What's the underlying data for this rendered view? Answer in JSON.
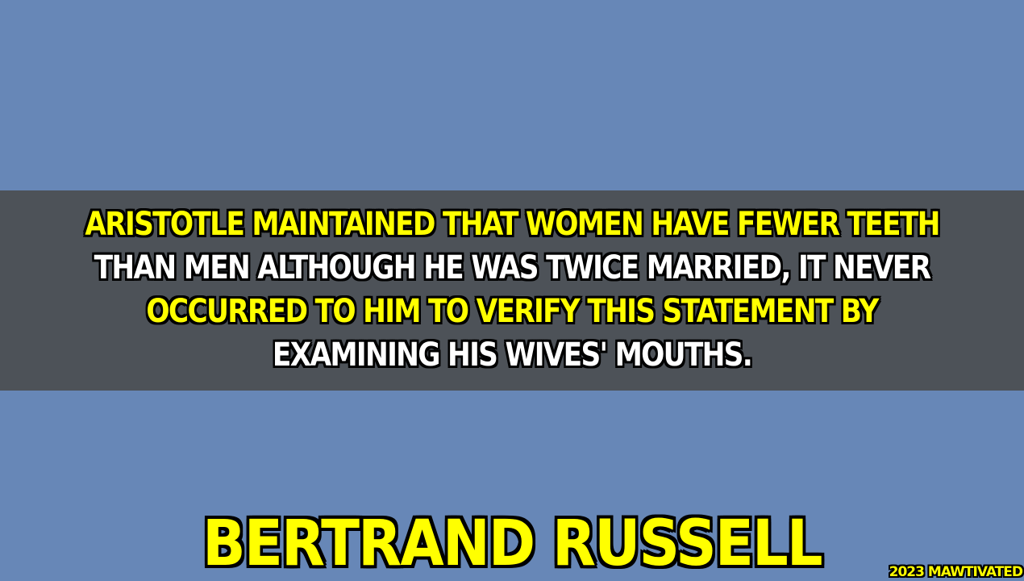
{
  "quote": {
    "lines": [
      "ARISTOTLE MAINTAINED THAT WOMEN HAVE FEWER TEETH",
      "THAN MEN ALTHOUGH HE WAS TWICE MARRIED, IT NEVER",
      "OCCURRED TO HIM TO VERIFY THIS STATEMENT BY",
      "EXAMINING HIS WIVES' MOUTHS."
    ]
  },
  "author": "BERTRAND RUSSELL",
  "credit": "2023 MAWTIVATED",
  "colors": {
    "background": "#6787b7",
    "band": "#4d5258",
    "accent_yellow": "#ffff00",
    "text_white": "#ffffff",
    "outline": "#000000"
  }
}
